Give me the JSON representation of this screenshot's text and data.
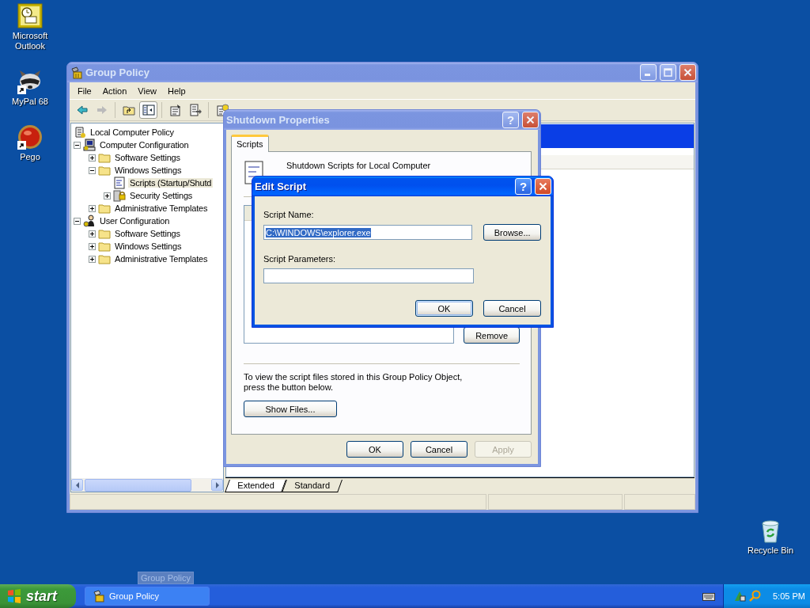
{
  "desktop_icons": [
    {
      "label": "Microsoft Outlook",
      "kind": "outlook",
      "shortcut": false
    },
    {
      "label": "MyPal 68",
      "kind": "raccoon",
      "shortcut": true
    },
    {
      "label": "Pego",
      "kind": "ball",
      "shortcut": true
    }
  ],
  "recycle_bin": {
    "label": "Recycle Bin"
  },
  "main_window": {
    "title": "Group Policy",
    "active": false,
    "menu": [
      "File",
      "Action",
      "View",
      "Help"
    ],
    "toolbar": [
      {
        "kind": "back",
        "pressed": false
      },
      {
        "kind": "forward",
        "pressed": false
      },
      {
        "kind": "separator"
      },
      {
        "kind": "up",
        "pressed": false
      },
      {
        "kind": "tree",
        "pressed": true
      },
      {
        "kind": "separator"
      },
      {
        "kind": "properties",
        "pressed": false
      },
      {
        "kind": "export",
        "pressed": false
      },
      {
        "kind": "separator"
      },
      {
        "kind": "help",
        "pressed": false
      }
    ],
    "tree": [
      {
        "label": "Local Computer Policy",
        "kind": "policy",
        "selected": false,
        "children": [
          {
            "label": "Computer Configuration",
            "kind": "computer",
            "selected": false,
            "expanded": true,
            "children": [
              {
                "label": "Software Settings",
                "kind": "folder",
                "selected": false,
                "expanded": false
              },
              {
                "label": "Windows Settings",
                "kind": "folder",
                "selected": false,
                "expanded": true,
                "children": [
                  {
                    "label": "Scripts (Startup/Shutd",
                    "kind": "script",
                    "selected": true
                  },
                  {
                    "label": "Security Settings",
                    "kind": "security",
                    "selected": false,
                    "expanded": false
                  }
                ]
              },
              {
                "label": "Administrative Templates",
                "kind": "folder",
                "selected": false,
                "expanded": false
              }
            ]
          },
          {
            "label": "User Configuration",
            "kind": "user",
            "selected": false,
            "expanded": true,
            "children": [
              {
                "label": "Software Settings",
                "kind": "folder",
                "selected": false,
                "expanded": false
              },
              {
                "label": "Windows Settings",
                "kind": "folder",
                "selected": false,
                "expanded": false
              },
              {
                "label": "Administrative Templates",
                "kind": "folder",
                "selected": false,
                "expanded": false
              }
            ]
          }
        ]
      }
    ],
    "view_tabs": [
      {
        "label": "Extended",
        "selected": true
      },
      {
        "label": "Standard",
        "selected": false
      }
    ]
  },
  "shutdown_dialog": {
    "title": "Shutdown Properties",
    "active": false,
    "help_glyph": "?",
    "tabs": [
      {
        "label": "Scripts",
        "selected": true
      }
    ],
    "heading": "Shutdown Scripts for Local Computer",
    "remove_button": "Remove",
    "note": "To view the script files stored in this Group Policy Object, press the button below.",
    "show_files_button": "Show Files...",
    "buttons": [
      {
        "label": "OK",
        "disabled": false
      },
      {
        "label": "Cancel",
        "disabled": false
      },
      {
        "label": "Apply",
        "disabled": true
      }
    ]
  },
  "edit_dialog": {
    "title": "Edit Script",
    "active": true,
    "help_glyph": "?",
    "fields": [
      {
        "label": "Script Name:",
        "value": "C:\\WINDOWS\\explorer.exe",
        "text_selected": true,
        "button": "Browse..."
      },
      {
        "label": "Script Parameters:"
      }
    ],
    "buttons": [
      {
        "label": "OK",
        "default": true
      },
      {
        "label": "Cancel",
        "default": false
      }
    ]
  },
  "taskbar": {
    "start": "start",
    "tasks": [
      {
        "label": "Group Policy",
        "selected": false
      }
    ],
    "tooltip": "Group Policy",
    "clock": "5:05 PM"
  }
}
